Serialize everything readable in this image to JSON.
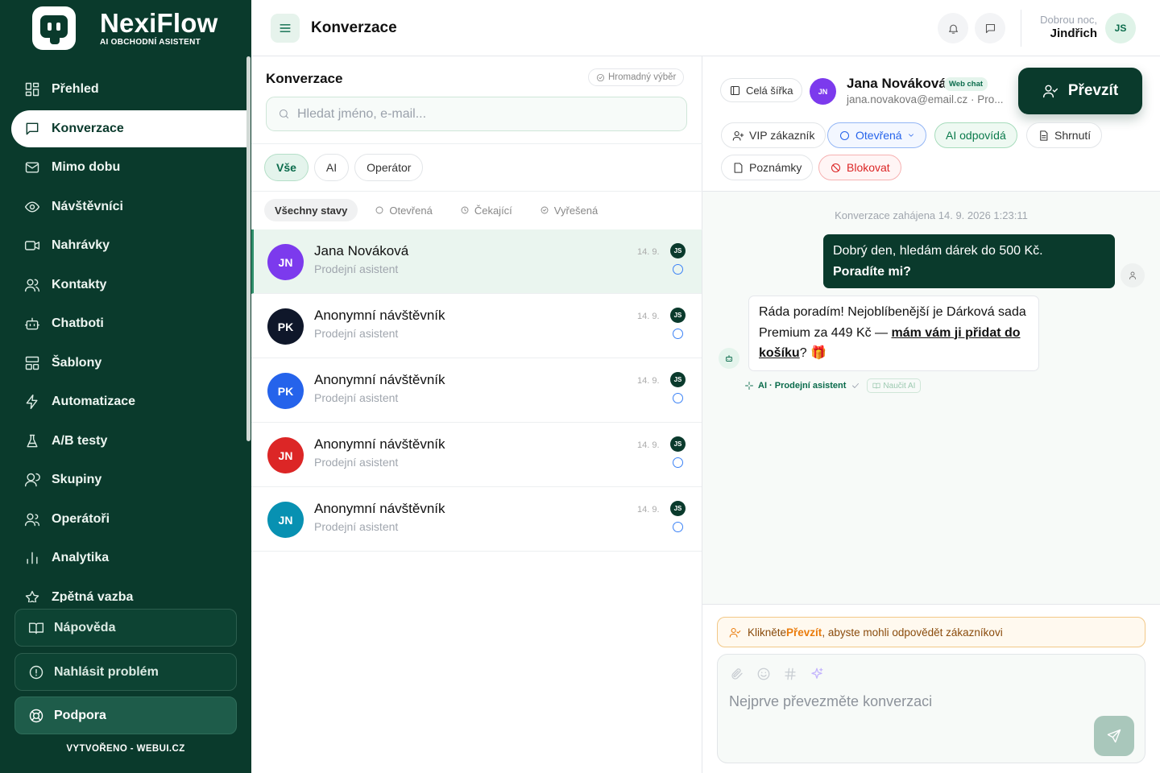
{
  "brand": {
    "name": "NexiFlow",
    "subtitle": "AI OBCHODNÍ ASISTENT"
  },
  "nav": [
    {
      "label": "Přehled",
      "icon": "dashboard-icon"
    },
    {
      "label": "Konverzace",
      "icon": "chat-icon",
      "active": true
    },
    {
      "label": "Mimo dobu",
      "icon": "mail-icon"
    },
    {
      "label": "Návštěvníci",
      "icon": "eye-icon"
    },
    {
      "label": "Nahrávky",
      "icon": "video-icon"
    },
    {
      "label": "Kontakty",
      "icon": "users-icon"
    },
    {
      "label": "Chatboti",
      "icon": "bot-icon"
    },
    {
      "label": "Šablony",
      "icon": "template-icon"
    },
    {
      "label": "Automatizace",
      "icon": "zap-icon"
    },
    {
      "label": "A/B testy",
      "icon": "flask-icon"
    },
    {
      "label": "Skupiny",
      "icon": "group-icon"
    },
    {
      "label": "Operátoři",
      "icon": "operators-icon"
    },
    {
      "label": "Analytika",
      "icon": "chart-icon"
    },
    {
      "label": "Zpětná vazba",
      "icon": "star-icon"
    }
  ],
  "sidebar_footer": {
    "help": "Nápověda",
    "report": "Nahlásit problém",
    "support": "Podpora",
    "created_by": "VYTVOŘENO - WEBUI.CZ"
  },
  "topbar": {
    "title": "Konverzace",
    "greeting": "Dobrou noc,",
    "user_name": "Jindřich",
    "user_initials": "JS"
  },
  "list": {
    "title": "Konverzace",
    "bulk_select": "Hromadný výběr",
    "search_placeholder": "Hledat jméno, e-mail...",
    "filters": [
      "Vše",
      "AI",
      "Operátor"
    ],
    "states": [
      "Všechny stavy",
      "Otevřená",
      "Čekající",
      "Vyřešená"
    ],
    "conversations": [
      {
        "initials": "JN",
        "name": "Jana Nováková",
        "assistant": "Prodejní asistent",
        "date": "14. 9.",
        "operator": "JS",
        "color": "#7c3aed",
        "active": true
      },
      {
        "initials": "PK",
        "name": "Anonymní návštěvník",
        "assistant": "Prodejní asistent",
        "date": "14. 9.",
        "operator": "JS",
        "color": "#0f172a"
      },
      {
        "initials": "PK",
        "name": "Anonymní návštěvník",
        "assistant": "Prodejní asistent",
        "date": "14. 9.",
        "operator": "JS",
        "color": "#2563eb"
      },
      {
        "initials": "JN",
        "name": "Anonymní návštěvník",
        "assistant": "Prodejní asistent",
        "date": "14. 9.",
        "operator": "JS",
        "color": "#dc2626"
      },
      {
        "initials": "JN",
        "name": "Anonymní návštěvník",
        "assistant": "Prodejní asistent",
        "date": "14. 9.",
        "operator": "JS",
        "color": "#0891b2"
      }
    ]
  },
  "detail": {
    "full_width": "Celá šířka",
    "contact_initials": "JN",
    "contact_name": "Jana Nováková",
    "channel_badge": "Web chat",
    "contact_email": "jana.novakova@email.cz · Pro...",
    "take_over": "Převzít",
    "actions": {
      "vip": "VIP zákazník",
      "status": "Otevřená",
      "ai": "AI odpovídá",
      "summary": "Shrnutí",
      "notes": "Poznámky",
      "block": "Blokovat"
    },
    "started": "Konverzace zahájena 14. 9. 2026 1:23:11",
    "user_msg_line1": "Dobrý den, hledám dárek do 500 Kč.",
    "user_msg_line2": "Poradíte mi?",
    "bot_msg_part1": "Ráda poradím! Nejoblíbenější je Dárková sada Premium za 449 Kč — ",
    "bot_msg_link": "mám vám ji přidat do košíku",
    "bot_msg_part2": "? 🎁",
    "bot_meta": "AI · Prodejní asistent",
    "teach_ai": "Naučit AI",
    "notice_before": "Klikněte ",
    "notice_bold": "Převzít",
    "notice_after": ", abyste mohli odpovědět zákazníkovi",
    "composer_placeholder": "Nejprve převezměte konverzaci"
  }
}
